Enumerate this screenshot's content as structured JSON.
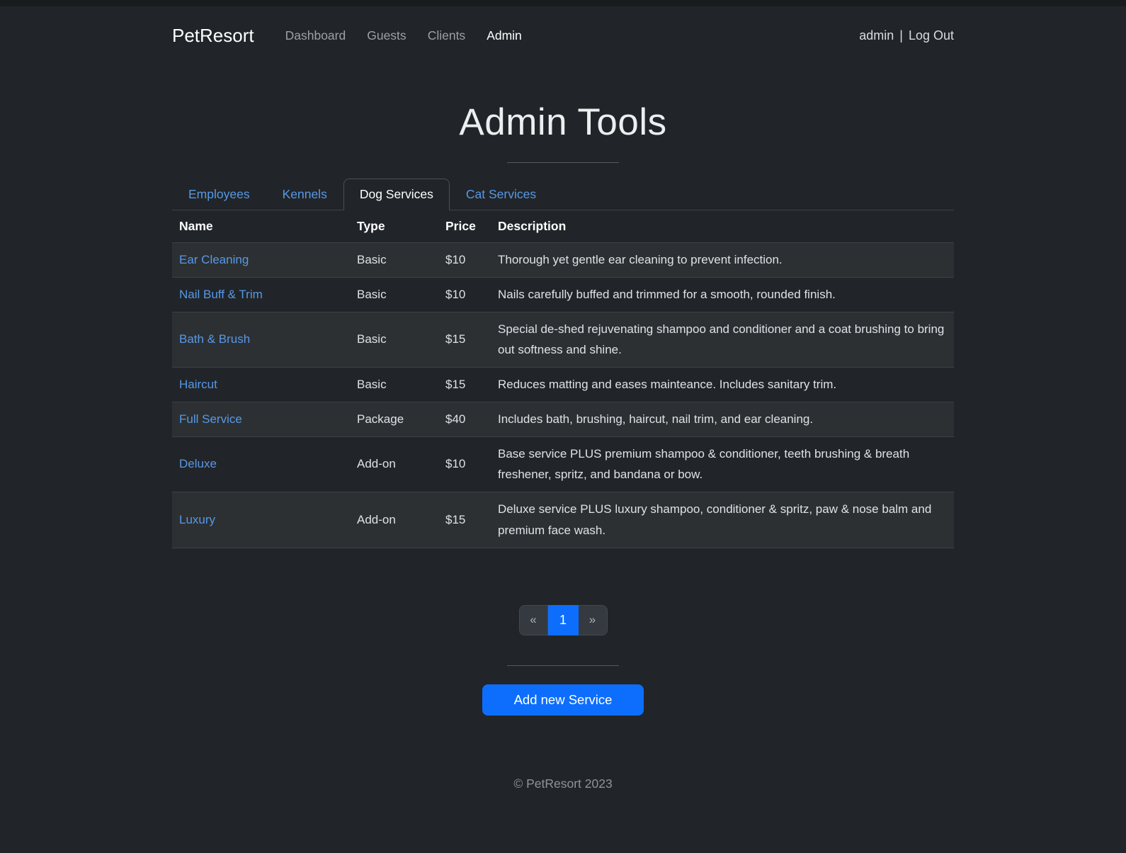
{
  "colors": {
    "page_bg": "#212529",
    "accent_blue": "#0d6efd",
    "link_blue": "#5898e6",
    "text_light": "#dee2e6",
    "border_gray": "#3c4146"
  },
  "navbar": {
    "brand": "PetResort",
    "links": [
      {
        "label": "Dashboard",
        "active": false
      },
      {
        "label": "Guests",
        "active": false
      },
      {
        "label": "Clients",
        "active": false
      },
      {
        "label": "Admin",
        "active": true
      }
    ],
    "user": "admin",
    "divider": "|",
    "logout": "Log Out"
  },
  "page": {
    "title": "Admin Tools"
  },
  "tabs": [
    {
      "label": "Employees",
      "active": false
    },
    {
      "label": "Kennels",
      "active": false
    },
    {
      "label": "Dog Services",
      "active": true
    },
    {
      "label": "Cat Services",
      "active": false
    }
  ],
  "table": {
    "headers": [
      "Name",
      "Type",
      "Price",
      "Description"
    ],
    "rows": [
      {
        "name": "Ear Cleaning",
        "type": "Basic",
        "price": "$10",
        "description": "Thorough yet gentle ear cleaning to prevent infection."
      },
      {
        "name": "Nail Buff & Trim",
        "type": "Basic",
        "price": "$10",
        "description": "Nails carefully buffed and trimmed for a smooth, rounded finish."
      },
      {
        "name": "Bath & Brush",
        "type": "Basic",
        "price": "$15",
        "description": "Special de-shed rejuvenating shampoo and conditioner and a coat brushing to bring out softness and shine."
      },
      {
        "name": "Haircut",
        "type": "Basic",
        "price": "$15",
        "description": "Reduces matting and eases mainteance. Includes sanitary trim."
      },
      {
        "name": "Full Service",
        "type": "Package",
        "price": "$40",
        "description": "Includes bath, brushing, haircut, nail trim, and ear cleaning."
      },
      {
        "name": "Deluxe",
        "type": "Add-on",
        "price": "$10",
        "description": "Base service PLUS premium shampoo & conditioner, teeth brushing & breath freshener, spritz, and bandana or bow."
      },
      {
        "name": "Luxury",
        "type": "Add-on",
        "price": "$15",
        "description": "Deluxe service PLUS luxury shampoo, conditioner & spritz, paw & nose balm and premium face wash."
      }
    ]
  },
  "pagination": {
    "prev": "«",
    "current": "1",
    "next": "»"
  },
  "actions": {
    "add_service": "Add new Service"
  },
  "footer": {
    "copyright": "© PetResort 2023"
  }
}
